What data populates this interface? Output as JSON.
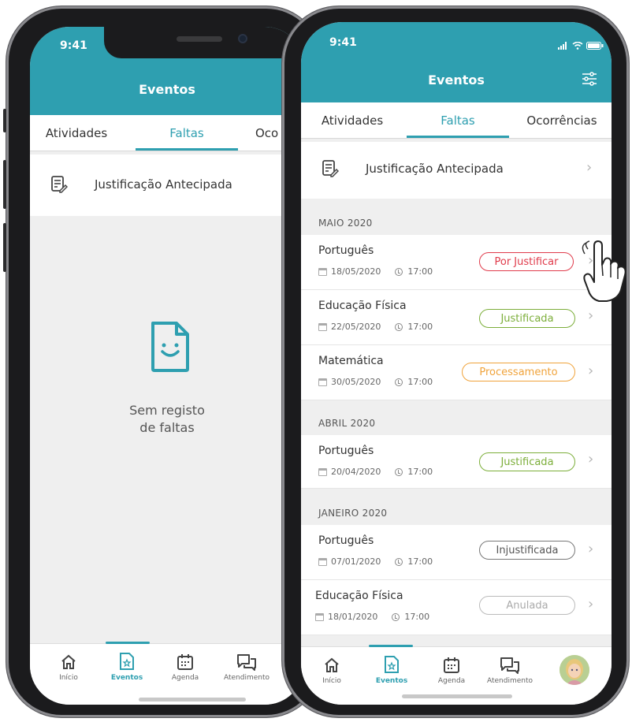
{
  "colors": {
    "accent": "#2e9fb0",
    "red": "#e03b4b",
    "green": "#7cae3a",
    "orange": "#f0a33b",
    "gray": "#888888",
    "lightgray": "#b5b5b5"
  },
  "back_phone": {
    "status_time": "9:41",
    "title": "Eventos",
    "tabs": [
      {
        "label": "Atividades"
      },
      {
        "label": "Faltas"
      },
      {
        "label": "Oco"
      }
    ],
    "link": {
      "label": "Justificação Antecipada"
    },
    "empty": {
      "line1": "Sem registo",
      "line2": "de faltas"
    },
    "tabbar": [
      {
        "label": "Início",
        "icon": "home-icon"
      },
      {
        "label": "Eventos",
        "icon": "events-icon"
      },
      {
        "label": "Agenda",
        "icon": "calendar-icon"
      },
      {
        "label": "Atendimento",
        "icon": "chat-icon"
      }
    ]
  },
  "front_phone": {
    "status_time": "9:41",
    "title": "Eventos",
    "tabs": [
      {
        "label": "Atividades"
      },
      {
        "label": "Faltas"
      },
      {
        "label": "Ocorrências"
      }
    ],
    "link": {
      "label": "Justificação Antecipada"
    },
    "sections": [
      {
        "label": "MAIO 2020"
      },
      {
        "label": "ABRIL 2020"
      },
      {
        "label": "JANEIRO 2020"
      }
    ],
    "items": [
      {
        "subject": "Português",
        "date": "18/05/2020",
        "time": "17:00",
        "status": "Por Justificar"
      },
      {
        "subject": "Educação Física",
        "date": "22/05/2020",
        "time": "17:00",
        "status": "Justificada"
      },
      {
        "subject": "Matemática",
        "date": "30/05/2020",
        "time": "17:00",
        "status": "Processamento"
      },
      {
        "subject": "Português",
        "date": "20/04/2020",
        "time": "17:00",
        "status": "Justificada"
      },
      {
        "subject": "Português",
        "date": "07/01/2020",
        "time": "17:00",
        "status": "Injustificada"
      },
      {
        "subject": "Educação Física",
        "date": "18/01/2020",
        "time": "17:00",
        "status": "Anulada"
      }
    ],
    "tabbar": [
      {
        "label": "Início",
        "icon": "home-icon"
      },
      {
        "label": "Eventos",
        "icon": "events-icon"
      },
      {
        "label": "Agenda",
        "icon": "calendar-icon"
      },
      {
        "label": "Atendimento",
        "icon": "chat-icon"
      },
      {
        "label": "",
        "icon": "avatar"
      }
    ]
  }
}
